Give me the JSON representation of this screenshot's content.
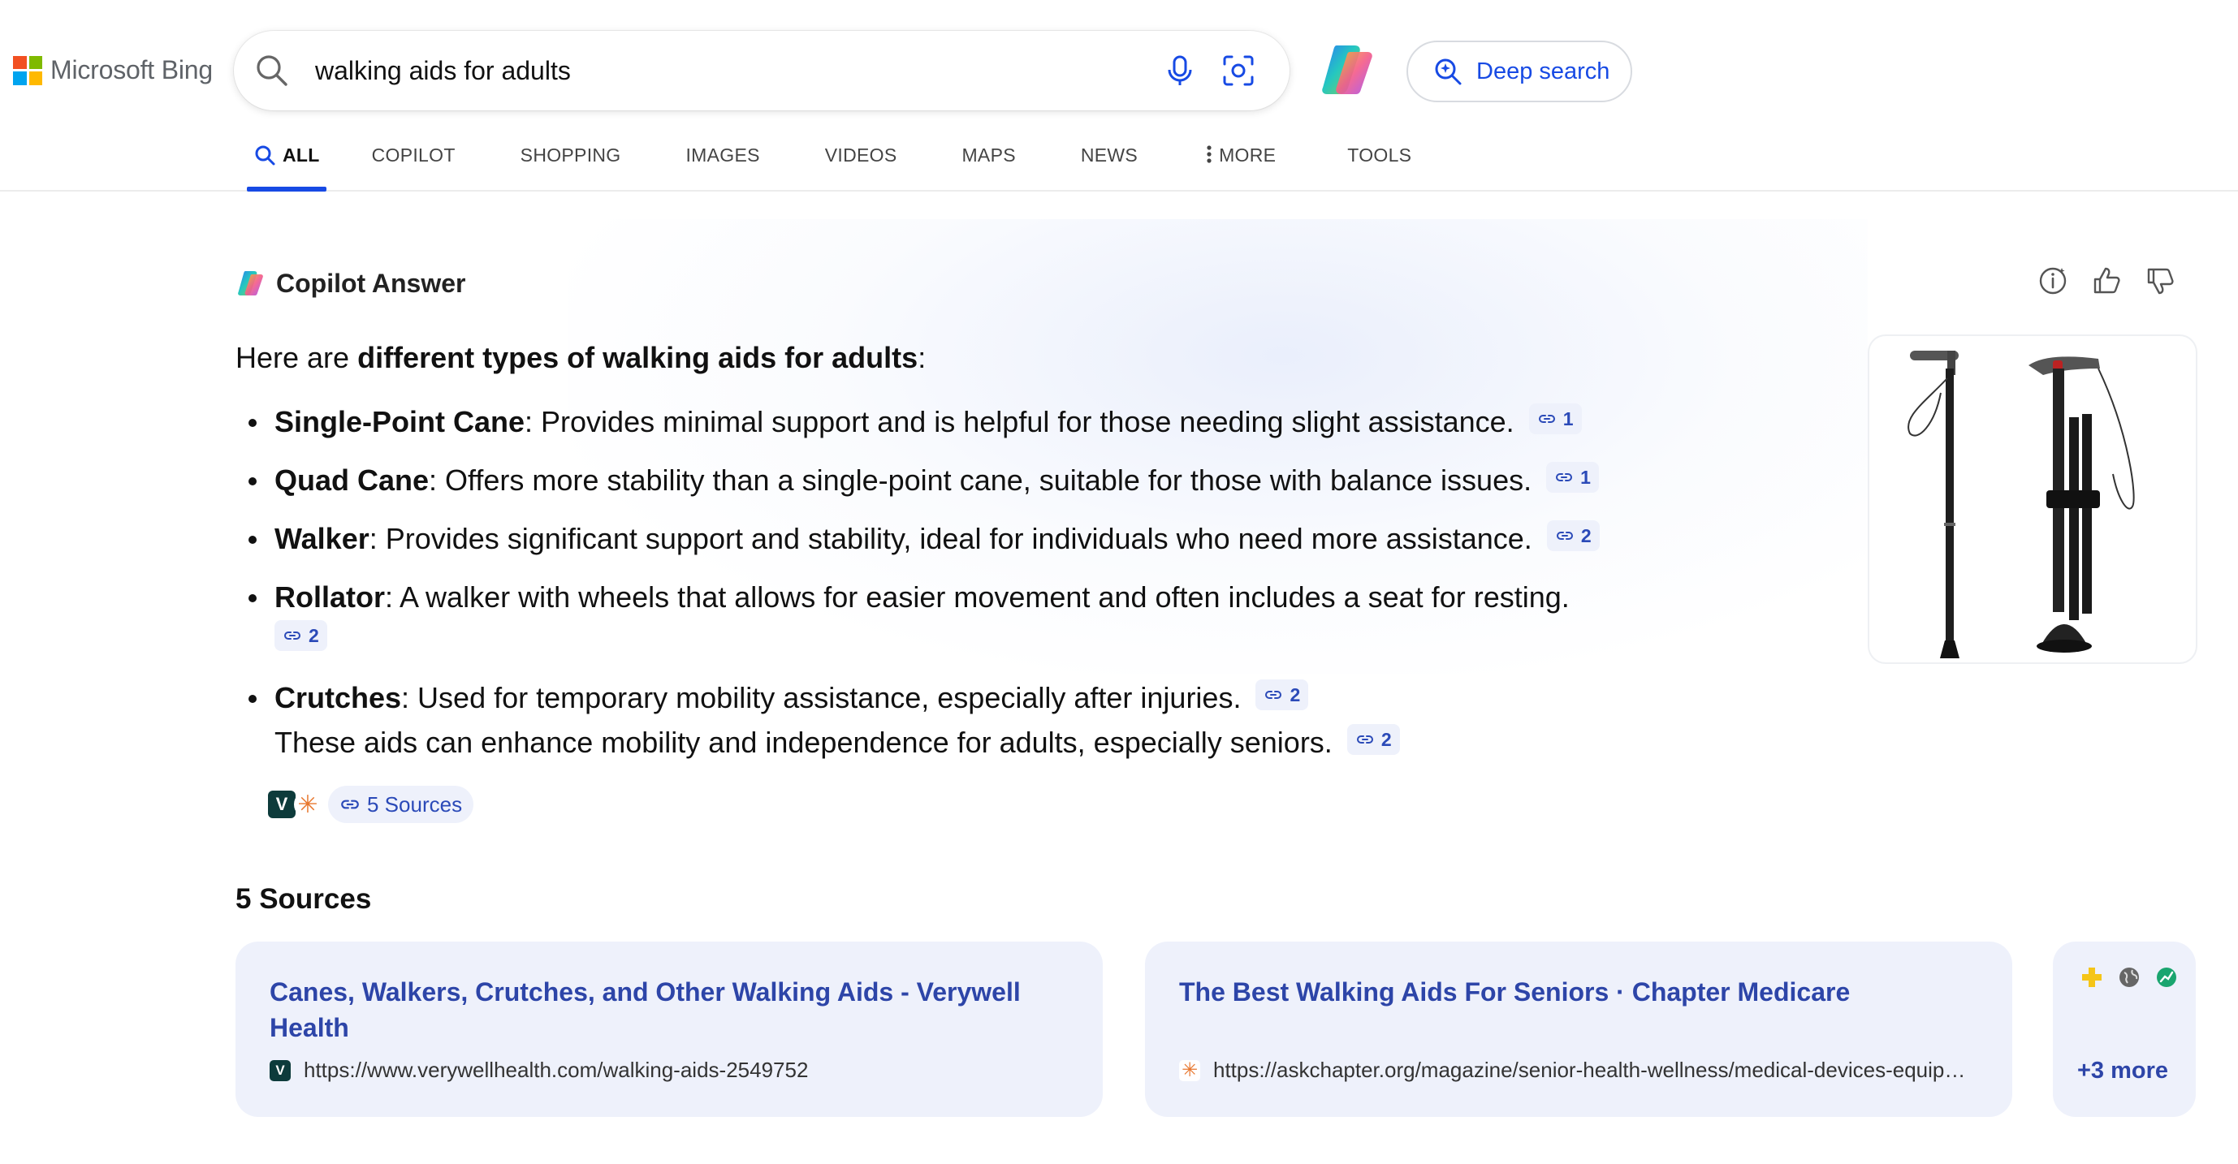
{
  "brand": {
    "name": "Microsoft Bing",
    "logo_colors": [
      "#f25022",
      "#7fba00",
      "#00a4ef",
      "#ffb900"
    ]
  },
  "search": {
    "query": "walking aids for adults",
    "icons": [
      "search-icon",
      "microphone-icon",
      "visual-search-icon"
    ]
  },
  "deep_search": {
    "label": "Deep search"
  },
  "tabs": [
    {
      "label": "ALL",
      "active": true
    },
    {
      "label": "COPILOT"
    },
    {
      "label": "SHOPPING"
    },
    {
      "label": "IMAGES"
    },
    {
      "label": "VIDEOS"
    },
    {
      "label": "MAPS"
    },
    {
      "label": "NEWS"
    },
    {
      "label": "MORE"
    },
    {
      "label": "TOOLS"
    }
  ],
  "answer": {
    "title": "Copilot Answer",
    "intro_prefix": "Here are ",
    "intro_bold": "different types of walking aids for adults",
    "intro_suffix": ":",
    "items": [
      {
        "term": "Single-Point Cane",
        "desc": ": Provides minimal support and is helpful for those needing slight assistance.",
        "cite": "1"
      },
      {
        "term": "Quad Cane",
        "desc": ": Offers more stability than a single-point cane, suitable for those with balance issues.",
        "cite": "1"
      },
      {
        "term": "Walker",
        "desc": ": Provides significant support and stability, ideal for individuals who need more assistance.",
        "cite": "2"
      },
      {
        "term": "Rollator",
        "desc": ": A walker with wheels that allows for easier movement and often includes a seat for resting.",
        "cite": "2"
      },
      {
        "term": "Crutches",
        "desc": ": Used for temporary mobility assistance, especially after injuries.",
        "cite": "2"
      }
    ],
    "closing": "These aids can enhance mobility and independence for adults, especially seniors.",
    "closing_cite": "2",
    "sources_pill": "5 Sources",
    "source_favicons": [
      "V",
      "✳"
    ]
  },
  "sources": {
    "title": "5 Sources",
    "cards": [
      {
        "title": "Canes, Walkers, Crutches, and Other Walking Aids - Verywell Health",
        "url": "https://www.verywellhealth.com/walking-aids-2549752",
        "favicon": "V"
      },
      {
        "title": "The Best Walking Aids For Seniors · Chapter Medicare",
        "url": "https://askchapter.org/magazine/senior-health-wellness/medical-devices-equip…",
        "favicon": "✳"
      }
    ],
    "more_label": "+3 more"
  },
  "colors": {
    "accent_blue": "#174ae4",
    "link_blue": "#2d45a8",
    "card_bg": "#eef1fb"
  }
}
